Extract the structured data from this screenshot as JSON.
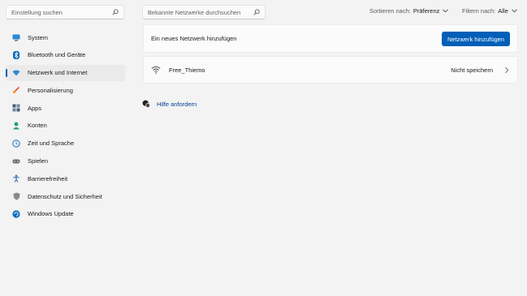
{
  "sidebar": {
    "search": {
      "placeholder": "Einstellung suchen",
      "icon": "search-icon"
    },
    "items": [
      {
        "label": "System",
        "icon": "system-icon",
        "color": "#0078d4"
      },
      {
        "label": "Bluetooth und Geräte",
        "icon": "bluetooth-icon",
        "color": "#0067c0"
      },
      {
        "label": "Netzwerk und Internet",
        "icon": "network-icon",
        "color": "#2b88d8",
        "active": true
      },
      {
        "label": "Personalisierung",
        "icon": "brush-icon",
        "color": "#e3562b"
      },
      {
        "label": "Apps",
        "icon": "apps-icon",
        "color": "#4a5e78"
      },
      {
        "label": "Konten",
        "icon": "accounts-icon",
        "color": "#1ba073"
      },
      {
        "label": "Zeit und Sprache",
        "icon": "time-language-icon",
        "color": "#2b7bc8"
      },
      {
        "label": "Spielen",
        "icon": "gaming-icon",
        "color": "#6b6b6b"
      },
      {
        "label": "Barrierefreiheit",
        "icon": "accessibility-icon",
        "color": "#3a6fb0"
      },
      {
        "label": "Datenschutz und Sicherheit",
        "icon": "shield-icon",
        "color": "#7a7a7a"
      },
      {
        "label": "Windows Update",
        "icon": "windows-update-icon",
        "color": "#0a6cc2"
      }
    ]
  },
  "main": {
    "network_search": {
      "placeholder": "Bekannte Netzwerke durchsuchen",
      "icon": "search-icon"
    },
    "sort": {
      "prefix": "Sortieren nach:",
      "value": "Präferenz"
    },
    "filter": {
      "prefix": "Filtern nach:",
      "value": "Alle"
    },
    "add_network": {
      "label": "Ein neues Netzwerk hinzufügen",
      "button": "Netzwerk hinzufügen"
    },
    "networks": [
      {
        "name": "Free_Thiemo",
        "action": "Nicht speichern",
        "icon": "wifi-icon"
      }
    ],
    "help": {
      "label": "Hilfe anfordern",
      "icon": "help-icon"
    }
  },
  "colors": {
    "accent": "#005fb8",
    "link": "#003e92",
    "background": "#f3f3f3",
    "card": "#fbfbfb"
  }
}
